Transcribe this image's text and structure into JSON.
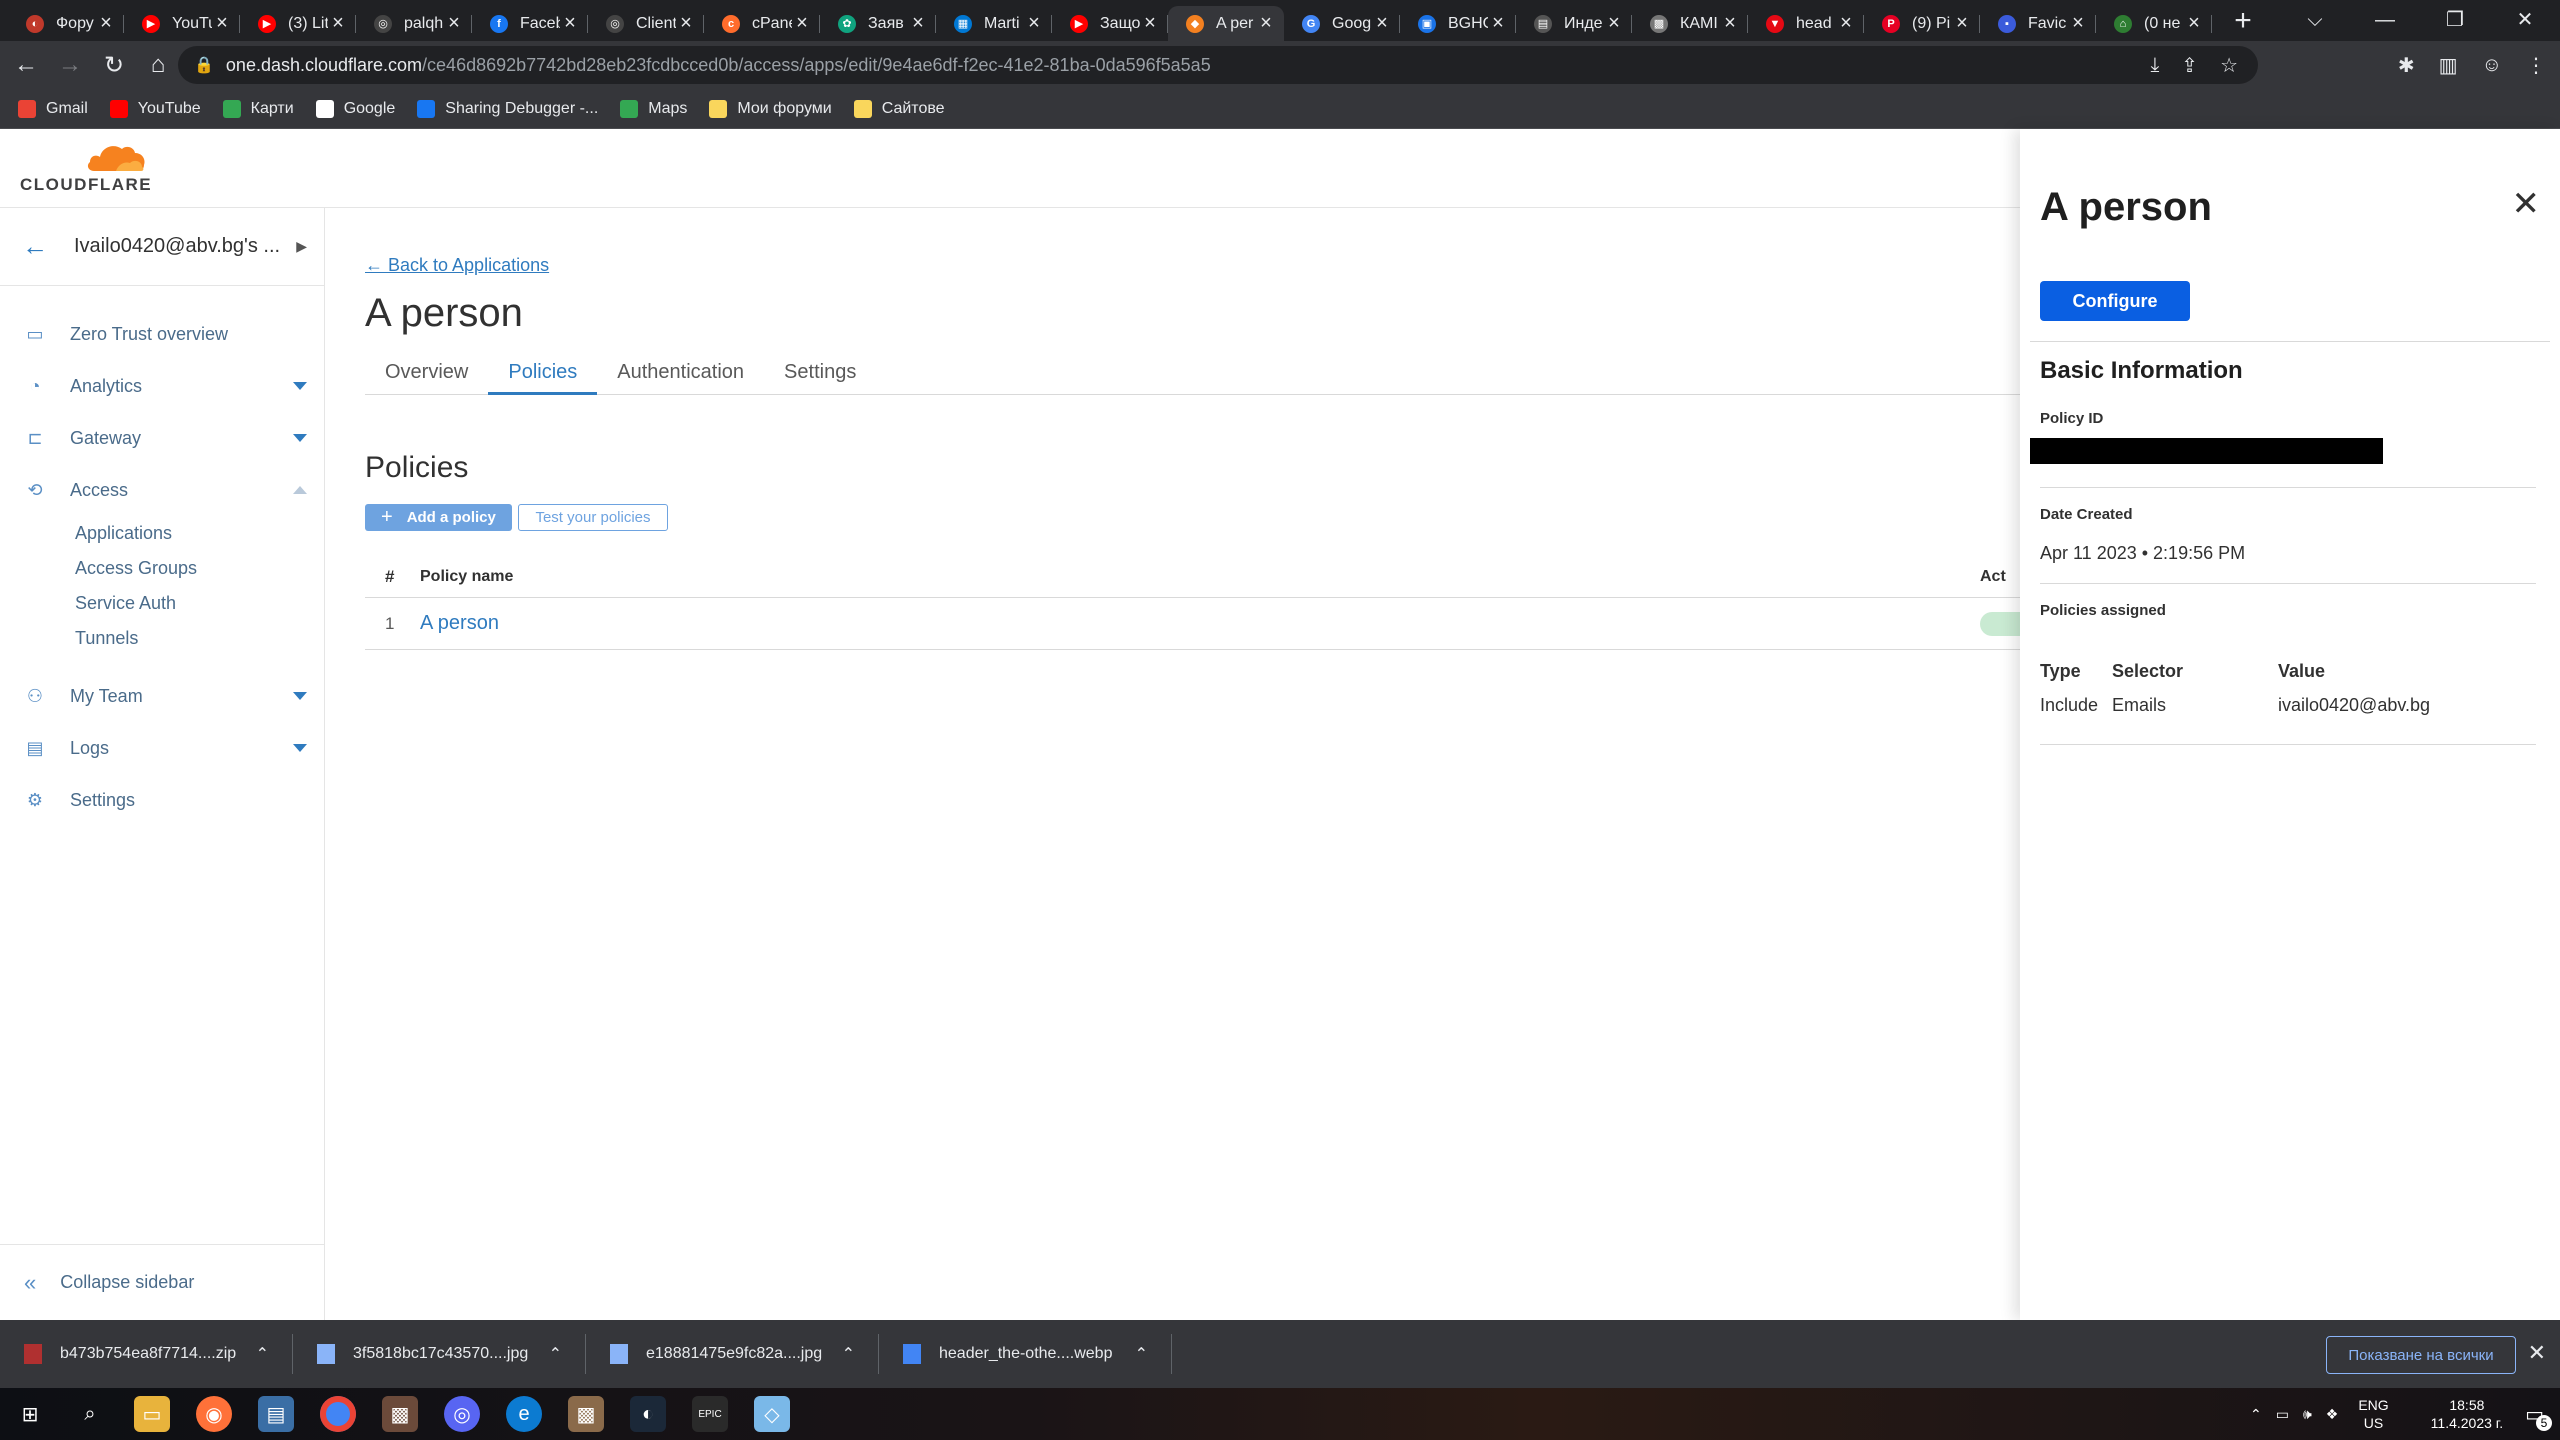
{
  "browser": {
    "tabs": [
      {
        "title": "Фору",
        "color": "#c0392b",
        "glyph": "◐"
      },
      {
        "title": "YouTu",
        "color": "#ff0000",
        "glyph": "▶"
      },
      {
        "title": "(3) Lit",
        "color": "#ff0000",
        "glyph": "▶"
      },
      {
        "title": "palqh",
        "color": "#444",
        "glyph": "◎"
      },
      {
        "title": "Faceb",
        "color": "#1877f2",
        "glyph": "f"
      },
      {
        "title": "Client",
        "color": "#444",
        "glyph": "◎"
      },
      {
        "title": "cPane",
        "color": "#ff6c2c",
        "glyph": "c"
      },
      {
        "title": "Заяв",
        "color": "#10a37f",
        "glyph": "✿"
      },
      {
        "title": "Marti",
        "color": "#0078d4",
        "glyph": "▦"
      },
      {
        "title": "Защо",
        "color": "#ff0000",
        "glyph": "▶"
      },
      {
        "title": "A per",
        "color": "#f38020",
        "glyph": "◆",
        "active": true
      },
      {
        "title": "Goog",
        "color": "#4285f4",
        "glyph": "G"
      },
      {
        "title": "BGHO",
        "color": "#1a73e8",
        "glyph": "▣"
      },
      {
        "title": "Инде",
        "color": "#555",
        "glyph": "▤"
      },
      {
        "title": "КАМІ",
        "color": "#777",
        "glyph": "▩"
      },
      {
        "title": "head",
        "color": "#e50914",
        "glyph": "▼"
      },
      {
        "title": "(9) Pi",
        "color": "#e60023",
        "glyph": "P"
      },
      {
        "title": "Favic",
        "color": "#3b5bdb",
        "glyph": "▪"
      },
      {
        "title": "(0 не",
        "color": "#2e7d32",
        "glyph": "⌂"
      }
    ],
    "url_host": "one.dash.cloudflare.com",
    "url_path": "/ce46d8692b7742bd28eb23fcdbcced0b/access/apps/edit/9e4ae6df-f2ec-41e2-81ba-0da596f5a5a5",
    "bookmarks": [
      {
        "label": "Gmail",
        "color": "#ea4335"
      },
      {
        "label": "YouTube",
        "color": "#ff0000"
      },
      {
        "label": "Карти",
        "color": "#34a853"
      },
      {
        "label": "Google",
        "color": "#ffffff"
      },
      {
        "label": "Sharing Debugger -...",
        "color": "#1877f2"
      },
      {
        "label": "Maps",
        "color": "#34a853"
      },
      {
        "label": "Мои форуми",
        "color": "#f9d65c"
      },
      {
        "label": "Сайтове",
        "color": "#f9d65c"
      }
    ]
  },
  "app": {
    "logo_text": "CLOUDFLARE",
    "account": "Ivailo0420@abv.bg's ...",
    "nav": [
      {
        "label": "Zero Trust overview",
        "icon": "layout-icon",
        "glyph": "▭",
        "dropdown": false
      },
      {
        "label": "Analytics",
        "icon": "analytics-icon",
        "glyph": "◔",
        "dropdown": true
      },
      {
        "label": "Gateway",
        "icon": "gateway-icon",
        "glyph": "⊏",
        "dropdown": true
      },
      {
        "label": "Access",
        "icon": "access-icon",
        "glyph": "⟲",
        "dropdown": "open",
        "children": [
          "Applications",
          "Access Groups",
          "Service Auth",
          "Tunnels"
        ]
      },
      {
        "label": "My Team",
        "icon": "team-icon",
        "glyph": "⚇",
        "dropdown": true
      },
      {
        "label": "Logs",
        "icon": "logs-icon",
        "glyph": "▤",
        "dropdown": true
      },
      {
        "label": "Settings",
        "icon": "settings-icon",
        "glyph": "⚙",
        "dropdown": false
      }
    ],
    "collapse_label": "Collapse sidebar",
    "back_link": "← Back to Applications",
    "page_title": "A person",
    "tabs": [
      "Overview",
      "Policies",
      "Authentication",
      "Settings"
    ],
    "active_tab": "Policies",
    "section_title": "Policies",
    "add_policy": "Add a policy",
    "test_policies": "Test your policies",
    "table": {
      "headers": {
        "num": "#",
        "name": "Policy name",
        "action": "Act"
      },
      "rows": [
        {
          "num": "1",
          "name": "A person"
        }
      ]
    }
  },
  "panel": {
    "title": "A person",
    "configure": "Configure",
    "basic_info": "Basic Information",
    "policy_id_label": "Policy ID",
    "date_label": "Date Created",
    "date_value": "Apr 11 2023 • 2:19:56 PM",
    "assigned_label": "Policies assigned",
    "headers": [
      "Type",
      "Selector",
      "Value"
    ],
    "rows": [
      [
        "Include",
        "Emails",
        "ivailo0420@abv.bg"
      ]
    ]
  },
  "downloads": {
    "items": [
      {
        "name": "b473b754ea8f7714....zip",
        "color": "#b03030"
      },
      {
        "name": "3f5818bc17c43570....jpg",
        "color": "#8ab4f8"
      },
      {
        "name": "e18881475e9fc82a....jpg",
        "color": "#8ab4f8"
      },
      {
        "name": "header_the-othe....webp",
        "color": "#4285f4"
      }
    ],
    "show_all": "Показване на всички"
  },
  "taskbar": {
    "lang_top": "ENG",
    "lang_bottom": "US",
    "time": "18:58",
    "date": "11.4.2023 г.",
    "notifications": "5"
  }
}
